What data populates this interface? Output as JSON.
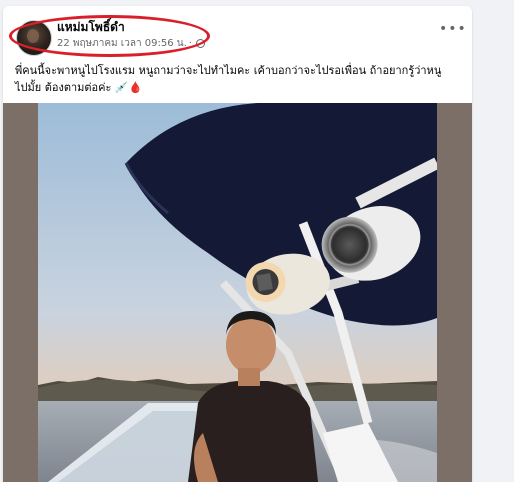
{
  "post": {
    "author_name": "แหม่มโพธิ์ดำ",
    "timestamp": "22 พฤษภาคม เวลา 09:56 น.",
    "separator": "·",
    "privacy_icon": "globe-icon",
    "more_icon": "more-options-icon",
    "more_label": "•••",
    "text_line1": "พี่คนนี้จะพาหนูไปโรงแรม หนูถามว่าจะไปทำไมคะ เค้าบอกว่าจะไปรอเพื่อน ถ้าอยากรู้ว่าหนู",
    "text_line2": "ไปมั้ย ต้องตามต่อค่ะ",
    "text_emoji": "💉🩸"
  },
  "colors": {
    "highlight": "#d9202a",
    "text": "#050505",
    "meta": "#65676b",
    "background": "#f0f2f5"
  }
}
